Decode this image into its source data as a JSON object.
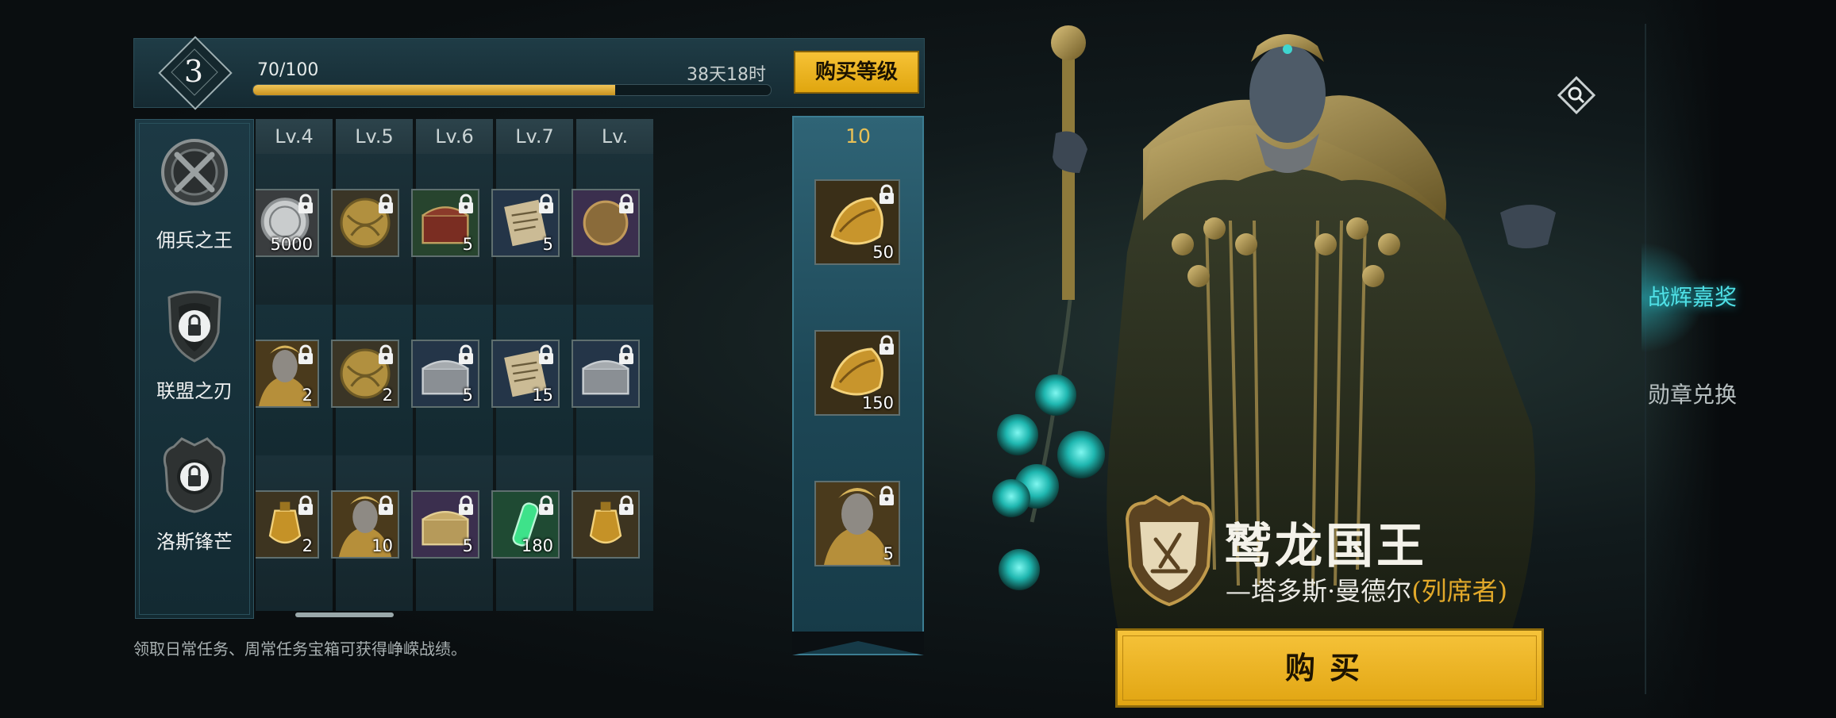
{
  "season": {
    "level": "3",
    "xp_text": "70/100",
    "xp_fraction": 0.7,
    "time_left": "38天18时",
    "buy_level_label": "购买等级"
  },
  "categories": [
    {
      "label": "佣兵之王",
      "icon": "crossed-swords-emblem-icon",
      "locked": false
    },
    {
      "label": "联盟之刃",
      "icon": "shield-lock-emblem-icon",
      "locked": true
    },
    {
      "label": "洛斯锋芒",
      "icon": "crest-lock-emblem-icon",
      "locked": true
    }
  ],
  "reward_columns": [
    {
      "level": "Lv.4",
      "rewards": [
        {
          "icon": "silver-coin",
          "qty": "5000"
        },
        {
          "icon": "hero-bust",
          "qty": "2"
        },
        {
          "icon": "golden-lantern",
          "qty": "2"
        }
      ]
    },
    {
      "level": "Lv.5",
      "rewards": [
        {
          "icon": "golden-orb",
          "qty": ""
        },
        {
          "icon": "golden-orb",
          "qty": "2"
        },
        {
          "icon": "hero-bust",
          "qty": "10"
        }
      ]
    },
    {
      "level": "Lv.6",
      "rewards": [
        {
          "icon": "red-chest",
          "qty": "5"
        },
        {
          "icon": "silver-chest",
          "qty": "5"
        },
        {
          "icon": "purple-chest",
          "qty": "5"
        }
      ]
    },
    {
      "level": "Lv.7",
      "rewards": [
        {
          "icon": "scroll",
          "qty": "5"
        },
        {
          "icon": "scroll",
          "qty": "15"
        },
        {
          "icon": "green-potion",
          "qty": "180"
        }
      ]
    },
    {
      "level": "Lv.",
      "rewards": [
        {
          "icon": "bronze-medal",
          "qty": ""
        },
        {
          "icon": "silver-chest",
          "qty": ""
        },
        {
          "icon": "golden-lantern",
          "qty": ""
        }
      ]
    }
  ],
  "milestone": {
    "level": "10",
    "rewards": [
      {
        "icon": "golden-talon",
        "qty": "50"
      },
      {
        "icon": "golden-talon",
        "qty": "150"
      },
      {
        "icon": "hero-bust",
        "qty": "5"
      }
    ]
  },
  "hint": "领取日常任务、周常任务宝箱可获得峥嵘战绩。",
  "hero": {
    "title": "鹫龙国王",
    "subtitle": "—塔多斯·曼德尔",
    "tag": "(列席者)",
    "buy_label": "购买"
  },
  "tabs": [
    {
      "label": "战辉嘉奖",
      "active": true
    },
    {
      "label": "勋章兑换",
      "active": false
    }
  ],
  "colors": {
    "accent_gold": "#f2bb2c",
    "accent_cyan": "#4fe0e6",
    "panel_teal": "#1d4756"
  }
}
